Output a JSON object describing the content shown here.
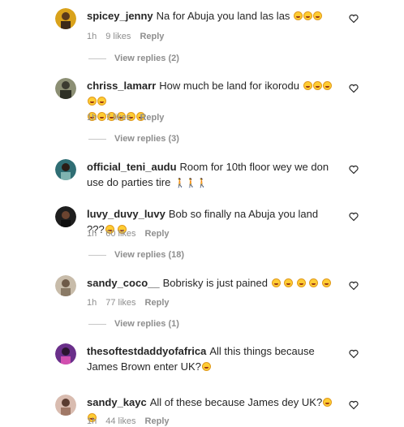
{
  "comments": [
    {
      "username": "spicey_jenny",
      "text": "Na for Abuja you land las las",
      "emoji_count": 3,
      "time": "1h",
      "likes": "9 likes",
      "reply": "Reply",
      "view_replies": "View replies (2)",
      "avatar_color": "#d9a21b"
    },
    {
      "username": "chriss_lamarr",
      "text": "How much be land for ikorodu",
      "emoji_count": 11,
      "time": "1h",
      "likes": "7 likes",
      "reply": "Reply",
      "view_replies": "View replies (3)",
      "avatar_color": "#6b7a5a"
    },
    {
      "username": "official_teni_audu",
      "text": "Room for 10th floor wey we don use do parties tire",
      "walkers": "🚶🚶🚶",
      "avatar_color": "#2f6e74"
    },
    {
      "username": "luvy_duvy_luvy",
      "text": "Bob so finally na Abuja you land ???",
      "emoji_count": 2,
      "time": "1h",
      "likes": "60 likes",
      "reply": "Reply",
      "view_replies": "View replies (18)",
      "avatar_color": "#1e1e1e"
    },
    {
      "username": "sandy_coco__",
      "text": "Bobrisky is just pained",
      "emoji_count": 5,
      "time": "1h",
      "likes": "77 likes",
      "reply": "Reply",
      "view_replies": "View replies (1)",
      "avatar_color": "#a89a88"
    },
    {
      "username": "thesoftestdaddyofafrica",
      "text": "All this things because James Brown enter UK?",
      "emoji_count": 1,
      "avatar_color": "#6a2f8a"
    },
    {
      "username": "sandy_kayc",
      "text": "All of these because James dey UK?",
      "emoji_count": 2,
      "time": "1h",
      "likes": "44 likes",
      "reply": "Reply",
      "avatar_color": "#b08a7a"
    }
  ]
}
